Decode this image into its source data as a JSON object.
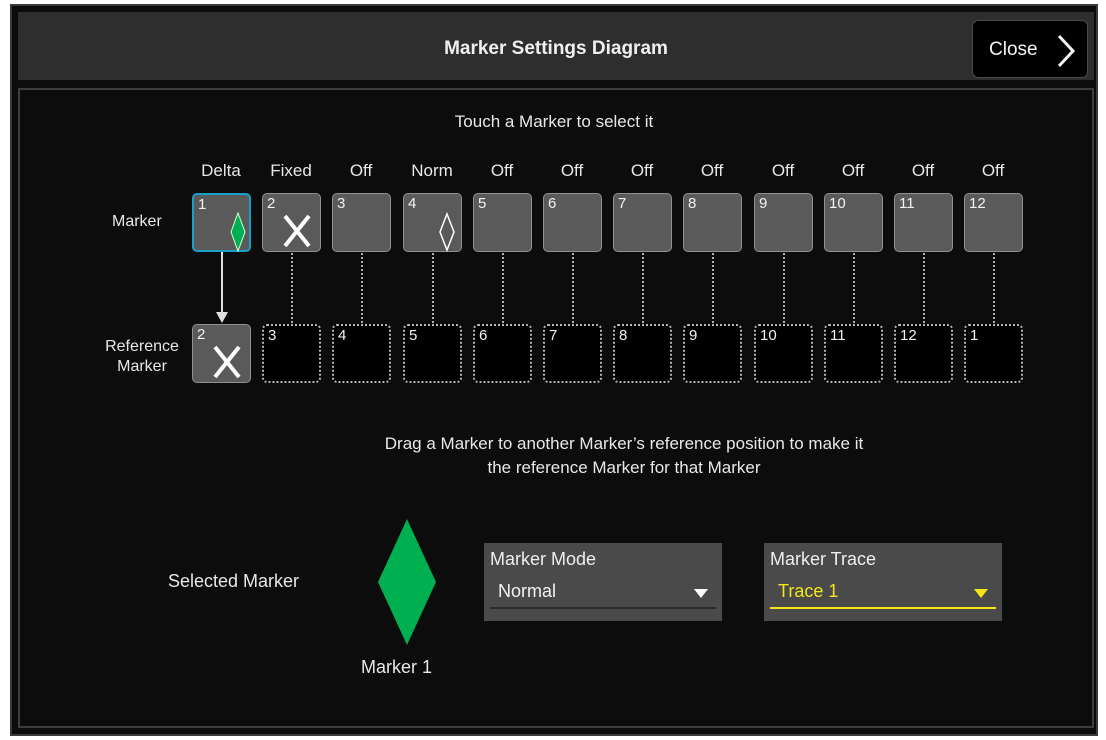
{
  "title": "Marker Settings Diagram",
  "close_label": "Close",
  "hint_top": "Touch a Marker to select it",
  "row_labels": {
    "marker": "Marker",
    "reference_line1": "Reference",
    "reference_line2": "Marker"
  },
  "markers": [
    {
      "num": "1",
      "state": "Delta",
      "icon": "green-diamond-icon",
      "ref": "2",
      "ref_icon": "x-icon"
    },
    {
      "num": "2",
      "state": "Fixed",
      "icon": "x-icon",
      "ref": "3"
    },
    {
      "num": "3",
      "state": "Off",
      "ref": "4"
    },
    {
      "num": "4",
      "state": "Norm",
      "icon": "hollow-diamond-icon",
      "ref": "5"
    },
    {
      "num": "5",
      "state": "Off",
      "ref": "6"
    },
    {
      "num": "6",
      "state": "Off",
      "ref": "7"
    },
    {
      "num": "7",
      "state": "Off",
      "ref": "8"
    },
    {
      "num": "8",
      "state": "Off",
      "ref": "9"
    },
    {
      "num": "9",
      "state": "Off",
      "ref": "10"
    },
    {
      "num": "10",
      "state": "Off",
      "ref": "11"
    },
    {
      "num": "11",
      "state": "Off",
      "ref": "12"
    },
    {
      "num": "12",
      "state": "Off",
      "ref": "1"
    }
  ],
  "hint_bottom_line1": "Drag a Marker to another Marker’s reference position to make it",
  "hint_bottom_line2": "the reference Marker for that Marker",
  "selected": {
    "label": "Selected Marker",
    "name": "Marker 1",
    "icon": "green-diamond-icon"
  },
  "marker_mode": {
    "label": "Marker Mode",
    "value": "Normal"
  },
  "marker_trace": {
    "label": "Marker Trace",
    "value": "Trace 1"
  },
  "colors": {
    "selection": "#1aa0c8",
    "marker_green": "#00b050",
    "trace_yellow": "#f5e61a"
  }
}
